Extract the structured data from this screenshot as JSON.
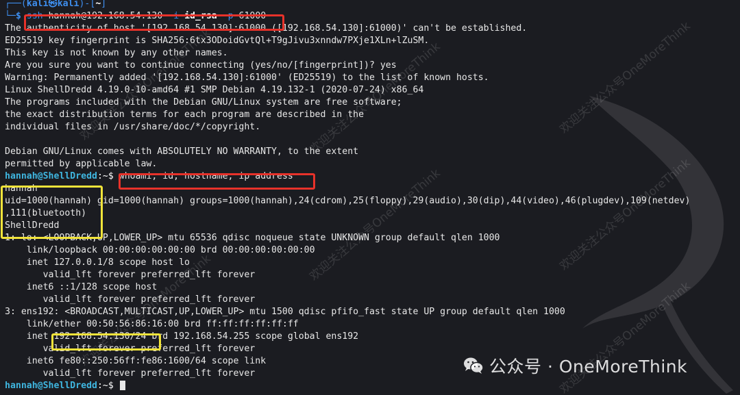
{
  "prompt_top": {
    "user": "kali",
    "at_symbol": "㉿",
    "host": "kali",
    "path": "~",
    "dollar": "$"
  },
  "command1": {
    "prefix": "ssh",
    "target": " hannah@192.168.54.130 ",
    "flag_i": "-i",
    "key": " id_rsa ",
    "flag_p": "-p",
    "port": " 61000"
  },
  "output1": [
    "The authenticity of host '[192.168.54.130]:61000 ([192.168.54.130]:61000)' can't be established.",
    "ED25519 key fingerprint is SHA256:6tx3ODoidGvtQl+T9gJivu3xnndw7PXje1XLn+lZuSM.",
    "This key is not known by any other names.",
    "Are you sure you want to continue connecting (yes/no/[fingerprint])? yes",
    "Warning: Permanently added '[192.168.54.130]:61000' (ED25519) to the list of known hosts.",
    "Linux ShellDredd 4.19.0-10-amd64 #1 SMP Debian 4.19.132-1 (2020-07-24) x86_64",
    "The programs included with the Debian GNU/Linux system are free software;",
    "the exact distribution terms for each program are described in the",
    "individual files in /usr/share/doc/*/copyright.",
    "",
    "Debian GNU/Linux comes with ABSOLUTELY NO WARRANTY, to the extent",
    "permitted by applicable law."
  ],
  "prompt2": {
    "user_host": "hannah@ShellDredd",
    "path": ":~",
    "dollar": "$ ",
    "command": "whoami; id; hostname; ip address"
  },
  "output2": [
    "hannah",
    "uid=1000(hannah) gid=1000(hannah) groups=1000(hannah),24(cdrom),25(floppy),29(audio),30(dip),44(video),46(plugdev),109(netdev)",
    ",111(bluetooth)",
    "ShellDredd",
    "1: lo: <LOOPBACK,UP,LOWER_UP> mtu 65536 qdisc noqueue state UNKNOWN group default qlen 1000",
    "    link/loopback 00:00:00:00:00:00 brd 00:00:00:00:00:00",
    "    inet 127.0.0.1/8 scope host lo",
    "       valid_lft forever preferred_lft forever",
    "    inet6 ::1/128 scope host",
    "       valid_lft forever preferred_lft forever",
    "3: ens192: <BROADCAST,MULTICAST,UP,LOWER_UP> mtu 1500 qdisc pfifo_fast state UP group default qlen 1000",
    "    link/ether 00:50:56:86:16:00 brd ff:ff:ff:ff:ff:ff"
  ],
  "inet_line": {
    "prefix": "    inet ",
    "ip": "192.168.54.130/24",
    "suffix": " brd 192.168.54.255 scope global ens192"
  },
  "output3": [
    "       valid_lft forever preferred_lft forever",
    "    inet6 fe80::250:56ff:fe86:1600/64 scope link",
    "       valid_lft forever preferred_lft forever"
  ],
  "prompt3": {
    "user_host": "hannah@ShellDredd",
    "path": ":~",
    "dollar": "$ "
  },
  "watermark_text": "欢迎关注公众号OneMoreThink",
  "brand": {
    "label": "公众号 · OneMoreThink",
    "icon": "wechat-icon"
  },
  "colors": {
    "background": "#1b1c21",
    "text": "#e8e8e8",
    "prompt": "#3e8ff0",
    "user_host": "#3fb6e0",
    "highlight_red": "#e8322a",
    "highlight_yellow": "#f2e43a"
  }
}
